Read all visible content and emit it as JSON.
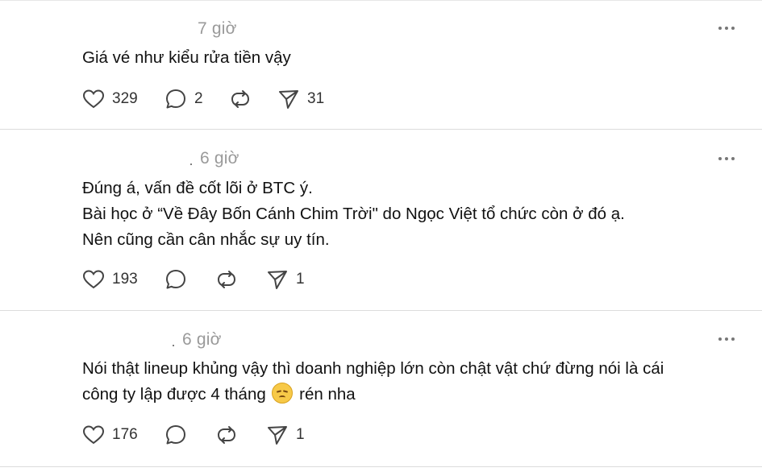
{
  "posts": [
    {
      "time": "7 giờ",
      "lines": [
        "Giá vé như kiểu rửa tiền vậy"
      ],
      "likes": "329",
      "replies": "2",
      "shares": "31"
    },
    {
      "time": "6 giờ",
      "lines": [
        "Đúng á, vấn đề cốt lõi ở BTC ý.",
        "Bài học ở “Về Đây Bốn Cánh Chim Trời\" do Ngọc Việt tổ chức còn ở đó ạ.",
        "Nên cũng cần cân nhắc sự uy tín."
      ],
      "likes": "193",
      "shares": "1"
    },
    {
      "time": "6 giờ",
      "lines": [
        "Nói thật lineup khủng vậy thì doanh nghiệp lớn còn chật vật chứ đừng nói là cái",
        "công ty lập được 4 tháng"
      ],
      "line2_suffix": "rén nha",
      "emoji": "pensive-face",
      "likes": "176",
      "shares": "1"
    }
  ],
  "icons": {
    "like": "heart-icon",
    "reply": "comment-bubble-icon",
    "repost": "repost-icon",
    "share": "send-icon",
    "more": "more-dots-icon"
  },
  "colors": {
    "time_text": "#9a9a9a",
    "body_text": "#111111",
    "icon": "#444444",
    "divider": "#dcdcdc"
  }
}
